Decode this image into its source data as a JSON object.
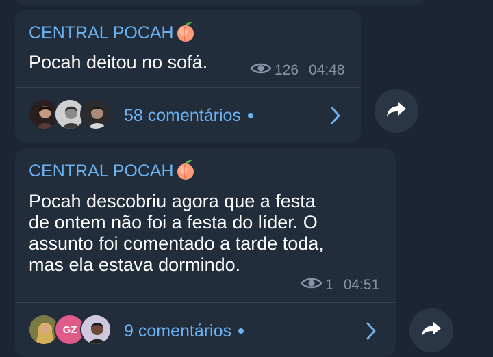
{
  "messages": [
    {
      "channel": "CENTRAL POCAH",
      "text": "Pocah deitou no sofá.",
      "views": "126",
      "time": "04:48",
      "comments_label": "58 comentários"
    },
    {
      "channel": "CENTRAL POCAH",
      "text": "Pocah descobriu agora que a festa\nde ontem não foi a festa do líder. O\nassunto foi comentado a tarde toda,\nmas ela estava dormindo.",
      "views": "1",
      "time": "04:51",
      "comments_label": "9 comentários",
      "avatar_initials": "GZ"
    }
  ],
  "icons": {
    "views": "eye-icon",
    "comments_open": "chevron-right-icon",
    "share": "share-arrow-icon",
    "channel_emoji": "peach-icon"
  },
  "colors": {
    "background": "#1b2533",
    "bubble": "#222d3c",
    "accent": "#6ab2f2",
    "meta": "#8595a7",
    "avatar_gz": "#e05a8a"
  }
}
